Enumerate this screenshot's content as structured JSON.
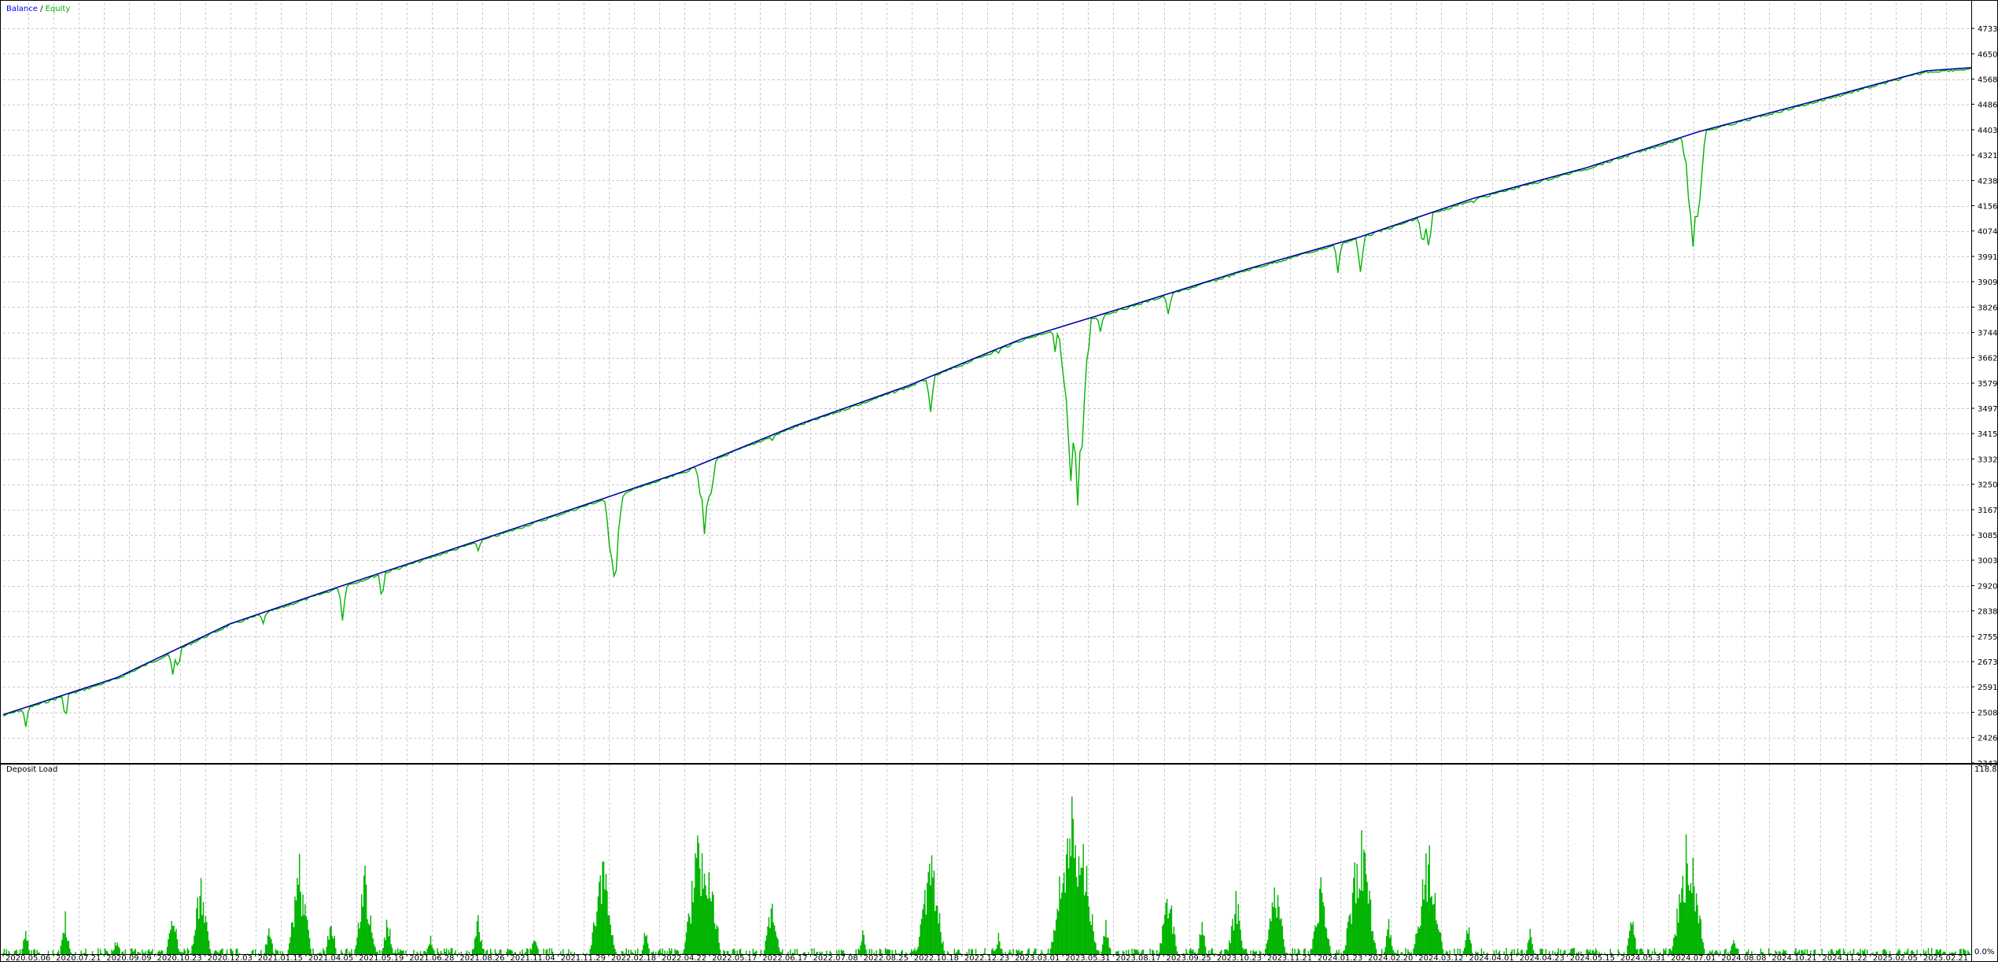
{
  "chart_data": [
    {
      "type": "line",
      "title_parts": [
        {
          "text": "Balance",
          "color": "#0000ff"
        },
        {
          "text": " / ",
          "color": "#000000"
        },
        {
          "text": "Equity",
          "color": "#00b000"
        }
      ],
      "colors": {
        "balance": "#0000aa",
        "equity": "#00b400"
      },
      "ylim": [
        2343,
        4815
      ],
      "yticks": [
        2343,
        2426,
        2508,
        2591,
        2673,
        2755,
        2838,
        2920,
        3003,
        3085,
        3167,
        3250,
        3332,
        3415,
        3497,
        3579,
        3662,
        3744,
        3826,
        3909,
        3991,
        4074,
        4156,
        4238,
        4321,
        4403,
        4486,
        4568,
        4650,
        4733
      ],
      "series": [
        {
          "name": "Balance",
          "points": [
            [
              0,
              2500
            ],
            [
              100,
              2620
            ],
            [
              200,
              2795
            ],
            [
              300,
              2920
            ],
            [
              400,
              3042
            ],
            [
              500,
              3165
            ],
            [
              600,
              3290
            ],
            [
              700,
              3440
            ],
            [
              800,
              3570
            ],
            [
              900,
              3722
            ],
            [
              1000,
              3835
            ],
            [
              1100,
              3950
            ],
            [
              1200,
              4055
            ],
            [
              1300,
              4180
            ],
            [
              1400,
              4280
            ],
            [
              1500,
              4398
            ],
            [
              1600,
              4495
            ],
            [
              1620,
              4515
            ],
            [
              1700,
              4595
            ],
            [
              1740,
              4605
            ]
          ]
        },
        {
          "name": "Equity",
          "baseline": "Balance",
          "dips": [
            [
              20,
              2450
            ],
            [
              55,
              2445
            ],
            [
              150,
              2595
            ],
            [
              155,
              2605
            ],
            [
              230,
              2778
            ],
            [
              300,
              2790
            ],
            [
              335,
              2850
            ],
            [
              420,
              3025
            ],
            [
              540,
              2875
            ],
            [
              620,
              3045
            ],
            [
              625,
              3110
            ],
            [
              680,
              3385
            ],
            [
              760,
              3535
            ],
            [
              820,
              3440
            ],
            [
              880,
              3675
            ],
            [
              930,
              3680
            ],
            [
              945,
              3135
            ],
            [
              950,
              3140
            ],
            [
              970,
              3735
            ],
            [
              1030,
              3770
            ],
            [
              1070,
              3945
            ],
            [
              1140,
              4015
            ],
            [
              1180,
              3915
            ],
            [
              1200,
              3910
            ],
            [
              1255,
              3978
            ],
            [
              1260,
              3980
            ],
            [
              1300,
              4158
            ],
            [
              1340,
              4230
            ],
            [
              1390,
              4355
            ],
            [
              1440,
              4400
            ],
            [
              1480,
              4420
            ],
            [
              1495,
              3965
            ],
            [
              1540,
              4545
            ]
          ]
        }
      ]
    },
    {
      "type": "bar",
      "title": "Deposit Load",
      "color": "#00b400",
      "ylim": [
        0,
        118.8
      ],
      "yticks": [
        "118.8%",
        "0.0%"
      ],
      "peaks": [
        [
          20,
          20
        ],
        [
          55,
          30
        ],
        [
          100,
          12
        ],
        [
          150,
          35
        ],
        [
          175,
          55
        ],
        [
          235,
          25
        ],
        [
          262,
          65
        ],
        [
          290,
          30
        ],
        [
          320,
          60
        ],
        [
          340,
          30
        ],
        [
          378,
          15
        ],
        [
          420,
          30
        ],
        [
          470,
          15
        ],
        [
          530,
          70
        ],
        [
          568,
          20
        ],
        [
          615,
          85
        ],
        [
          625,
          60
        ],
        [
          680,
          45
        ],
        [
          760,
          18
        ],
        [
          820,
          75
        ],
        [
          880,
          15
        ],
        [
          945,
          118
        ],
        [
          952,
          95
        ],
        [
          975,
          25
        ],
        [
          1030,
          50
        ],
        [
          1060,
          25
        ],
        [
          1090,
          45
        ],
        [
          1125,
          55
        ],
        [
          1165,
          55
        ],
        [
          1200,
          90
        ],
        [
          1225,
          25
        ],
        [
          1260,
          80
        ],
        [
          1295,
          25
        ],
        [
          1350,
          20
        ],
        [
          1440,
          30
        ],
        [
          1490,
          90
        ],
        [
          1530,
          12
        ]
      ],
      "ticks_x": [
        "2020.05.06",
        "2020.07.21",
        "2020.09.09",
        "2020.10.23",
        "2020.12.03",
        "2021.01.15",
        "2021.04.05",
        "2021.05.19",
        "2021.06.28",
        "2021.08.26",
        "2021.11.04",
        "2021.11.29",
        "2022.02.18",
        "2022.04.22",
        "2022.05.17",
        "2022.06.17",
        "2022.07.08",
        "2022.08.25",
        "2022.10.18",
        "2022.12.23",
        "2023.03.01",
        "2023.05.31",
        "2023.08.17",
        "2023.09.25",
        "2023.10.23",
        "2023.11.21",
        "2024.01.23",
        "2024.02.20",
        "2024.03.12",
        "2024.04.01",
        "2024.04.23",
        "2024.05.15",
        "2024.05.31",
        "2024.07.01",
        "2024.08.08",
        "2024.10.21",
        "2024.11.22",
        "2025.02.05",
        "2025.02.21"
      ]
    }
  ]
}
